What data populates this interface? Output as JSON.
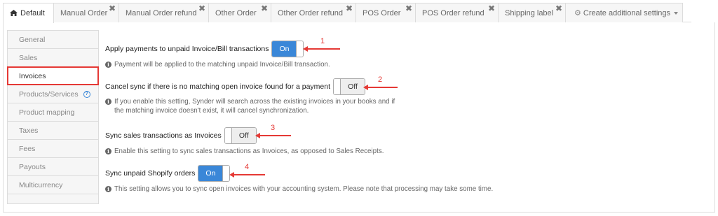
{
  "tabs": [
    {
      "label": "Default",
      "active": true,
      "icon": "home-icon"
    },
    {
      "label": "Manual Order",
      "closable": true
    },
    {
      "label": "Manual Order refund",
      "closable": true
    },
    {
      "label": "Other Order",
      "closable": true
    },
    {
      "label": "Other Order refund",
      "closable": true
    },
    {
      "label": "POS Order",
      "closable": true
    },
    {
      "label": "POS Order refund",
      "closable": true
    },
    {
      "label": "Shipping label",
      "closable": true
    },
    {
      "label": "Create additional settings",
      "icon": "gear-icon",
      "dropdown": true
    }
  ],
  "tab_close_glyph": "✖",
  "sidebar": {
    "items": [
      {
        "label": "General"
      },
      {
        "label": "Sales"
      },
      {
        "label": "Invoices",
        "active": true
      },
      {
        "label": "Products/Services",
        "help": "?"
      },
      {
        "label": "Product mapping"
      },
      {
        "label": "Taxes"
      },
      {
        "label": "Fees"
      },
      {
        "label": "Payouts"
      },
      {
        "label": "Multicurrency"
      }
    ]
  },
  "settings": [
    {
      "label": "Apply payments to unpaid Invoice/Bill transactions",
      "value": "On",
      "hint": "Payment will be applied to the matching unpaid Invoice/Bill transaction.",
      "annotation": "1"
    },
    {
      "label": "Cancel sync if there is no matching open invoice found for a payment",
      "value": "Off",
      "hint_line1": "If you enable this setting, Synder will search across the existing invoices in your books and if",
      "hint_line2": "the matching invoice doesn't exist, it will cancel synchronization.",
      "annotation": "2"
    },
    {
      "label": "Sync sales transactions as Invoices",
      "value": "Off",
      "hint": "Enable this setting to sync sales transactions as Invoices, as opposed to Sales Receipts.",
      "annotation": "3"
    },
    {
      "label": "Sync unpaid Shopify orders",
      "value": "On",
      "hint": "This setting allows you to sync open invoices with your accounting system. Please note that processing may take some time.",
      "annotation": "4"
    }
  ],
  "info_glyph": "i",
  "colors": {
    "accent": "#3a87d8",
    "annotation": "#e53935",
    "highlight_border": "#e53935"
  }
}
